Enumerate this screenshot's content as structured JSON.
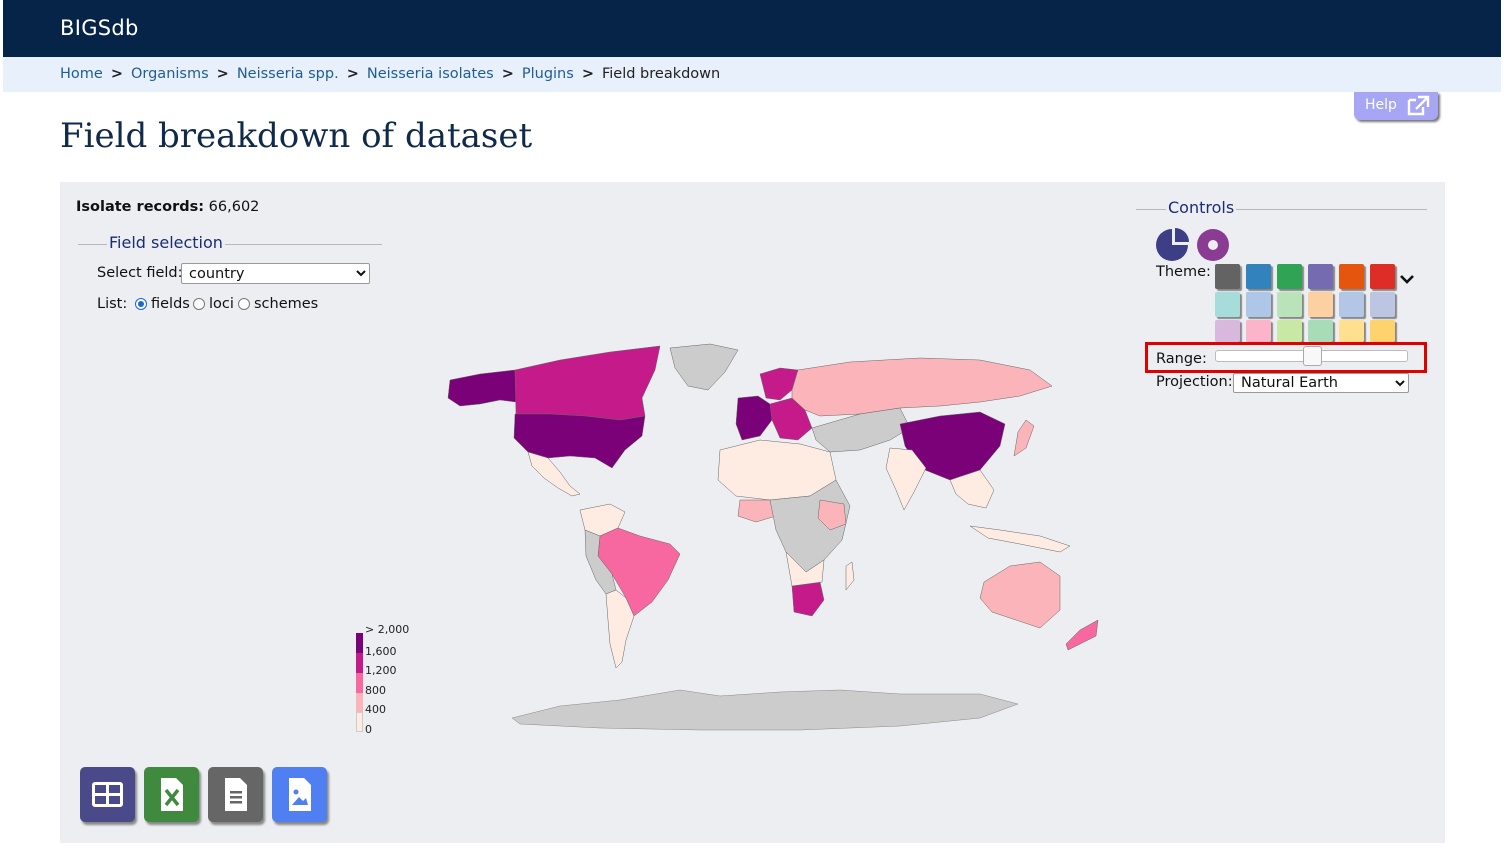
{
  "header": {
    "brand": "BIGSdb"
  },
  "breadcrumb": {
    "items": [
      "Home",
      "Organisms",
      "Neisseria spp.",
      "Neisseria isolates",
      "Plugins"
    ],
    "current": "Field breakdown",
    "separator": ">"
  },
  "help": {
    "label": "Help",
    "icon": "external-link-icon"
  },
  "page": {
    "title": "Field breakdown of dataset"
  },
  "records": {
    "label": "Isolate records:",
    "value": "66,602"
  },
  "field_selection": {
    "legend": "Field selection",
    "select_label": "Select field:",
    "select_value": "country",
    "list_label": "List:",
    "list_options": [
      "fields",
      "loci",
      "schemes"
    ],
    "list_selected": "fields"
  },
  "controls": {
    "legend": "Controls",
    "chart_icons": [
      "pie-chart-icon",
      "donut-chart-icon"
    ],
    "theme_label": "Theme:",
    "theme_swatches_row1": [
      "#636363",
      "#3182bd",
      "#31a354",
      "#756bb1",
      "#e6550d",
      "#de2d26"
    ],
    "theme_swatches_row2": [
      "#a6dcd9",
      "#aec7e8",
      "#b9e4b9",
      "#fdd0a2",
      "#b3c6e6",
      "#bcc6e3"
    ],
    "theme_swatches_row3": [
      "#d8b8dd",
      "#fbb4c9",
      "#c7e9a5",
      "#a8dbb7",
      "#ffe08f",
      "#ffd36b"
    ],
    "range_label": "Range:",
    "range_value_fraction": 0.48,
    "projection_label": "Projection:",
    "projection_value": "Natural Earth"
  },
  "map_legend": {
    "ticks": [
      "> 2,000",
      "1,600",
      "1,200",
      "800",
      "400",
      "0"
    ],
    "colors": [
      "#7a0177",
      "#c51b8a",
      "#f768a1",
      "#fbb4b9",
      "#feebe2"
    ]
  },
  "export_buttons": [
    {
      "name": "table-export-button",
      "icon": "table-icon",
      "color": "#4a4a8a"
    },
    {
      "name": "excel-export-button",
      "icon": "excel-icon",
      "color": "#3f8a3f"
    },
    {
      "name": "text-export-button",
      "icon": "text-file-icon",
      "color": "#666666"
    },
    {
      "name": "image-export-button",
      "icon": "image-file-icon",
      "color": "#4f7ff0"
    }
  ]
}
